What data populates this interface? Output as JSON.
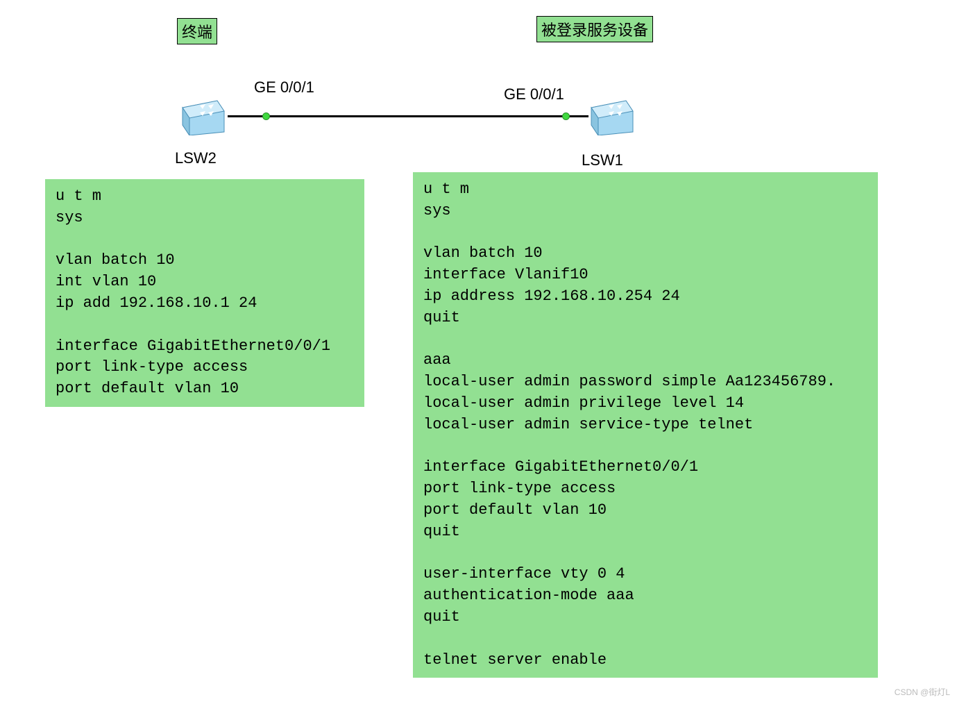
{
  "labels": {
    "terminal": "终端",
    "server": "被登录服务设备",
    "port_left": "GE 0/0/1",
    "port_right": "GE 0/0/1",
    "device_left": "LSW2",
    "device_right": "LSW1"
  },
  "icons": {
    "switch": "switch-icon"
  },
  "config": {
    "lsw2": "u t m\nsys\n\nvlan batch 10\nint vlan 10\nip add 192.168.10.1 24\n\ninterface GigabitEthernet0/0/1\nport link-type access\nport default vlan 10",
    "lsw1": "u t m\nsys\n\nvlan batch 10\ninterface Vlanif10\nip address 192.168.10.254 24\nquit\n\naaa\nlocal-user admin password simple Aa123456789.\nlocal-user admin privilege level 14\nlocal-user admin service-type telnet\n\ninterface GigabitEthernet0/0/1\nport link-type access\nport default vlan 10\nquit\n\nuser-interface vty 0 4\nauthentication-mode aaa\nquit\n\ntelnet server enable"
  },
  "watermark": "CSDN @街灯L"
}
